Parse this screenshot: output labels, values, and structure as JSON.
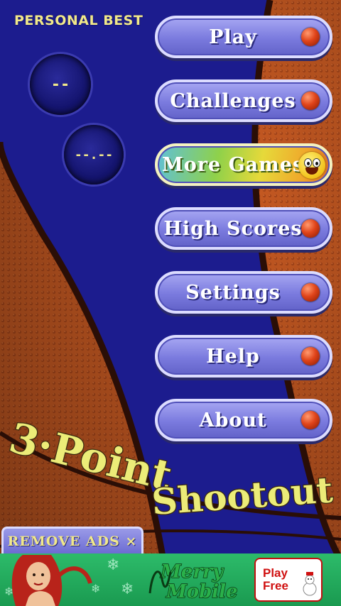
{
  "personal_best": {
    "title": "PERSONAL BEST",
    "score_1": "--",
    "score_2": "--.--"
  },
  "menu": {
    "items": [
      {
        "label": "Play"
      },
      {
        "label": "Challenges"
      },
      {
        "label": "More Games"
      },
      {
        "label": "High Scores"
      },
      {
        "label": "Settings"
      },
      {
        "label": "Help"
      },
      {
        "label": "About"
      }
    ]
  },
  "logo": {
    "line1": "3·Point",
    "line2": "Shootout"
  },
  "remove_ads": {
    "label": "REMOVE ADS ×"
  },
  "ad": {
    "brand_line1": "Merry",
    "brand_line2": "Mobile",
    "cta_line1": "Play",
    "cta_line2": "Free"
  },
  "colors": {
    "court_blue": "#1a1a8c",
    "basketball_orange": "#c65a20",
    "button_purple": "#7a7ade",
    "text_yellow": "#f1e88a",
    "ad_green": "#2dbb6a"
  },
  "icons": {
    "button_ball": "basketball-icon",
    "more_games": "smiley-face-icon",
    "ad_decoration": "snowflake-icon"
  }
}
